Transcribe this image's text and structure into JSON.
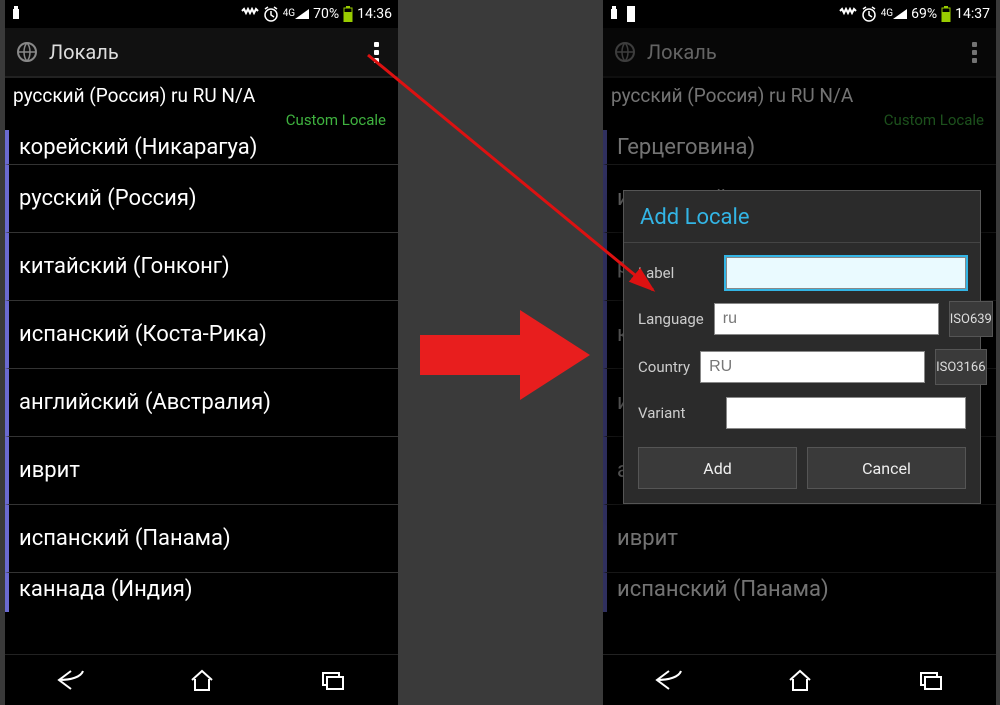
{
  "left": {
    "status": {
      "battery": "70%",
      "time": "14:36",
      "net": "4G"
    },
    "actionbar": {
      "title": "Локаль"
    },
    "current": "русский (Россия)  ru RU N/A",
    "custom_locale_label": "Custom Locale",
    "list": [
      "корейский (Никарагуа)",
      "русский (Россия)",
      "китайский (Гонконг)",
      "испанский (Коста-Рика)",
      "английский (Австралия)",
      "иврит",
      "испанский (Панама)",
      "каннада (Индия)"
    ]
  },
  "right": {
    "status": {
      "battery": "69%",
      "time": "14:37",
      "net": "4G"
    },
    "actionbar": {
      "title": "Локаль"
    },
    "current": "русский (Россия)  ru RU N/A",
    "custom_locale_label": "Custom Locale",
    "list": [
      "Герцеговина)",
      "испанский",
      "русский",
      "китайский",
      "испанский",
      "английский (Австралия)",
      "иврит",
      "испанский (Панама)"
    ]
  },
  "dialog": {
    "title": "Add Locale",
    "labels": {
      "label": "Label",
      "language": "Language",
      "country": "Country",
      "variant": "Variant"
    },
    "values": {
      "label": "",
      "language": "ru",
      "country": "RU",
      "variant": ""
    },
    "iso639": "ISO639",
    "iso3166": "ISO3166",
    "add": "Add",
    "cancel": "Cancel"
  }
}
